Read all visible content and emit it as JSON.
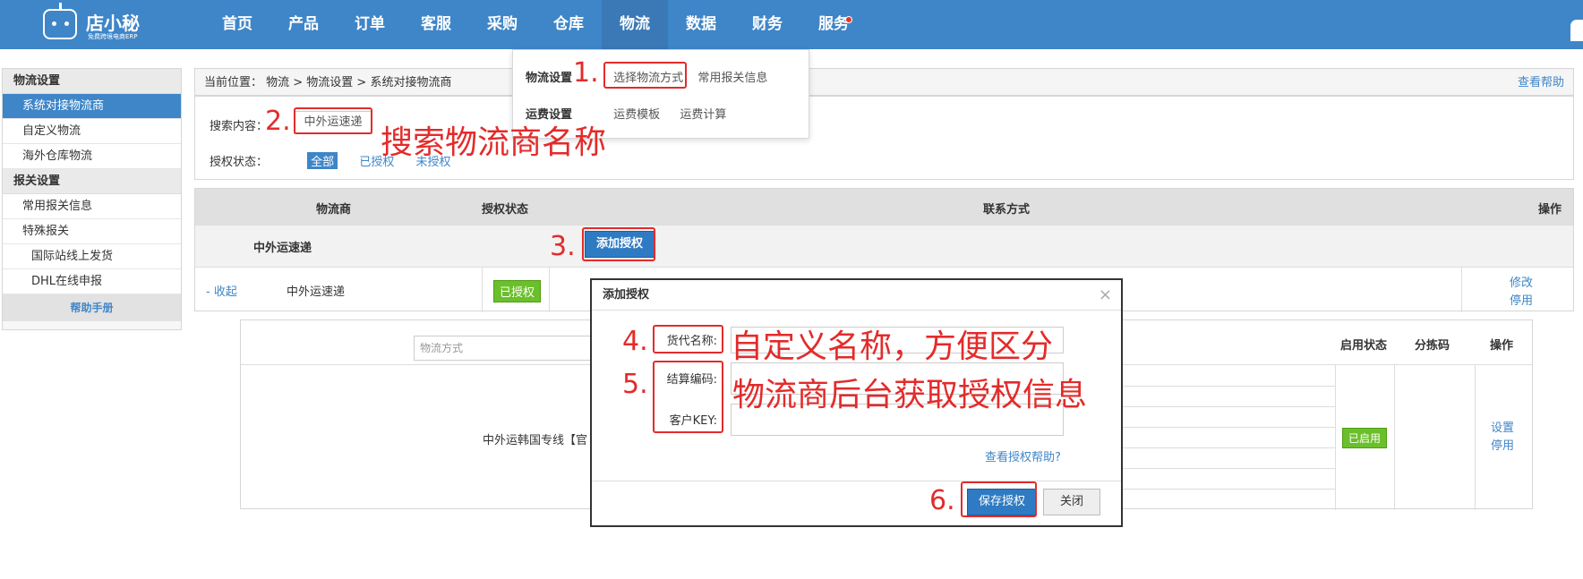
{
  "logo": {
    "name": "店小秘",
    "slogan": "免费跨境电商ERP"
  },
  "nav": [
    "首页",
    "产品",
    "订单",
    "客服",
    "采购",
    "仓库",
    "物流",
    "数据",
    "财务",
    "服务"
  ],
  "dropdown": {
    "row1_head": "物流设置",
    "row1_items": [
      "选择物流方式",
      "常用报关信息"
    ],
    "row2_head": "运费设置",
    "row2_items": [
      "运费模板",
      "运费计算"
    ]
  },
  "sidebar": {
    "head1": "物流设置",
    "items1": [
      "系统对接物流商",
      "自定义物流",
      "海外仓库物流"
    ],
    "head2": "报关设置",
    "items2": [
      "常用报关信息",
      "特殊报关"
    ],
    "sub_items": [
      "国际站线上发货",
      "DHL在线申报"
    ],
    "help": "帮助手册"
  },
  "breadcrumb": {
    "text": "当前位置： 物流 > 物流设置 > 系统对接物流商",
    "help": "查看帮助"
  },
  "search": {
    "label": "搜索内容：",
    "value": "中外运速递",
    "status_label": "授权状态：",
    "tabs": [
      "全部",
      "已授权",
      "未授权"
    ]
  },
  "table": {
    "headers": [
      "物流商",
      "授权状态",
      "联系方式",
      "操作"
    ],
    "group_name": "中外运速递",
    "add_button": "添加授权",
    "row": {
      "collapse": "- 收起",
      "name": "中外运速递",
      "status": "已授权",
      "ops": [
        "修改",
        "停用"
      ]
    }
  },
  "subtable": {
    "placeholder": "物流方式",
    "headers": [
      "启用状态",
      "分拣码",
      "操作"
    ],
    "method": "中外运韩国专线【官",
    "status": "已启用",
    "ops": [
      "设置",
      "停用"
    ]
  },
  "modal": {
    "title": "添加授权",
    "close": "×",
    "fields": [
      "货代名称:",
      "结算编码:",
      "客户KEY:"
    ],
    "help_link": "查看授权帮助?",
    "save": "保存授权",
    "cancel": "关闭"
  },
  "annotations": {
    "nums": [
      "1.",
      "2.",
      "3.",
      "4.",
      "5.",
      "6."
    ],
    "texts": [
      "搜索物流商名称",
      "自定义名称，方便区分",
      "物流商后台获取授权信息"
    ]
  }
}
